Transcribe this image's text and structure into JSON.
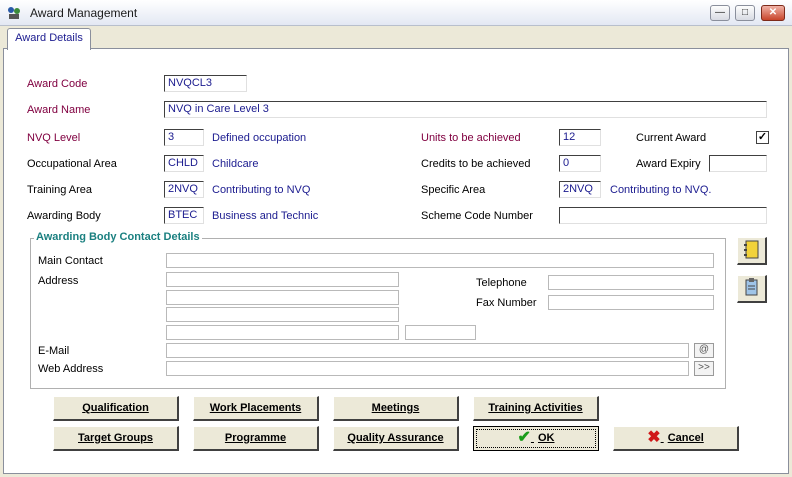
{
  "window": {
    "title": "Award Management",
    "minimize": "—",
    "maximize": "□",
    "close": "✕"
  },
  "tab": {
    "label": "Award Details"
  },
  "form": {
    "award_code_label": "Award Code",
    "award_code": "NVQCL3",
    "award_name_label": "Award Name",
    "award_name": "NVQ in Care Level 3",
    "nvq_level_label": "NVQ Level",
    "nvq_level": "3",
    "nvq_level_desc": "Defined occupation",
    "occ_area_label": "Occupational Area",
    "occ_area": "CHLD",
    "occ_area_desc": "Childcare",
    "training_area_label": "Training Area",
    "training_area": "2NVQ",
    "training_area_desc": "Contributing to NVQ",
    "awarding_body_label": "Awarding Body",
    "awarding_body": "BTEC",
    "awarding_body_desc": "Business and Technic",
    "units_label": "Units to be achieved",
    "units": "12",
    "credits_label": "Credits to be achieved",
    "credits": "0",
    "specific_area_label": "Specific Area",
    "specific_area": "2NVQ",
    "specific_area_desc": "Contributing to NVQ.",
    "scheme_label": "Scheme Code Number",
    "scheme": "",
    "current_award_label": "Current Award",
    "current_award_check": "✓",
    "award_expiry_label": "Award Expiry",
    "award_expiry": ""
  },
  "contact": {
    "title": "Awarding Body Contact Details",
    "main_contact_label": "Main Contact",
    "address_label": "Address",
    "telephone_label": "Telephone",
    "fax_label": "Fax Number",
    "email_label": "E-Mail",
    "web_label": "Web Address",
    "email_btn": "@",
    "web_btn": ">>"
  },
  "buttons": {
    "qualification": "Qualification",
    "work_placements": "Work Placements",
    "meetings": "Meetings",
    "training_activities": "Training Activities",
    "target_groups": "Target Groups",
    "programme": "Programme",
    "quality_assurance": "Quality Assurance",
    "ok": "OK",
    "cancel": "Cancel"
  },
  "colors": {
    "label_maroon": "#800040",
    "value_blue": "#1b1b8f",
    "group_teal": "#1b8080",
    "ok_green": "#1a9c1a",
    "cancel_red": "#d01818"
  }
}
